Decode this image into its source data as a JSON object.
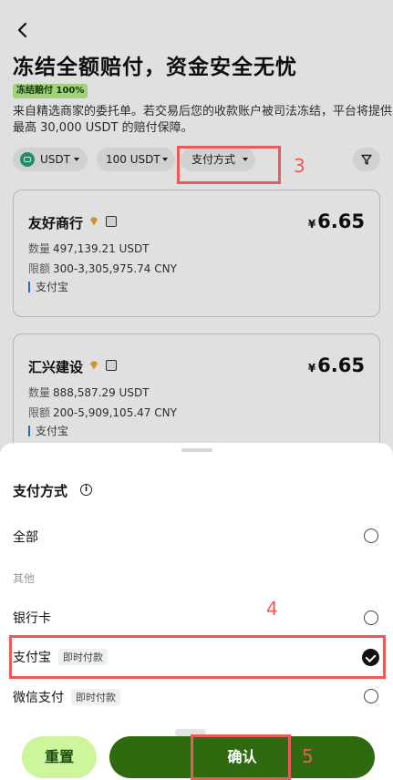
{
  "header": {
    "title": "冻结全额赔付，资金安全无忧",
    "badge": "冻结赔付 100%",
    "description": "来自精选商家的委托单。若交易后您的收款账户被司法冻结，平台将提供最高 30,000 USDT 的赔付保障。"
  },
  "filters": {
    "coin": "USDT",
    "amount": "100 USDT",
    "payment": "支付方式"
  },
  "merchants": [
    {
      "name": "友好商行",
      "currency": "¥",
      "price": "6.65",
      "qty_label": "数量",
      "qty": "497,139.21 USDT",
      "limit_label": "限额",
      "limit": "300-3,305,975.74 CNY",
      "payment": "支付宝"
    },
    {
      "name": "汇兴建设",
      "currency": "¥",
      "price": "6.65",
      "qty_label": "数量",
      "qty": "888,587.29 USDT",
      "limit_label": "限额",
      "limit": "200-5,909,105.47 CNY",
      "payment": "支付宝"
    }
  ],
  "sheet": {
    "title": "支付方式",
    "options": {
      "all": "全部",
      "section_other": "其他",
      "bank": "银行卡",
      "alipay": "支付宝",
      "alipay_tag": "即时付款",
      "wechat": "微信支付",
      "wechat_tag": "即时付款"
    },
    "selected": "支付宝",
    "reset": "重置",
    "confirm": "确认"
  },
  "annotations": [
    "3",
    "4",
    "5"
  ],
  "colors": {
    "badge_bg": "#b6f08c",
    "confirm_bg": "#2f6a10",
    "reset_bg": "#cdf59b",
    "annotation": "#ec5a5a",
    "alipay_bar": "#2c7be5"
  },
  "icons": [
    "back-arrow-icon",
    "usdt-coin-icon",
    "caret-down-icon",
    "filter-funnel-icon",
    "diamond-icon",
    "verified-user-icon",
    "info-icon",
    "radio-empty-icon",
    "radio-checked-icon"
  ]
}
